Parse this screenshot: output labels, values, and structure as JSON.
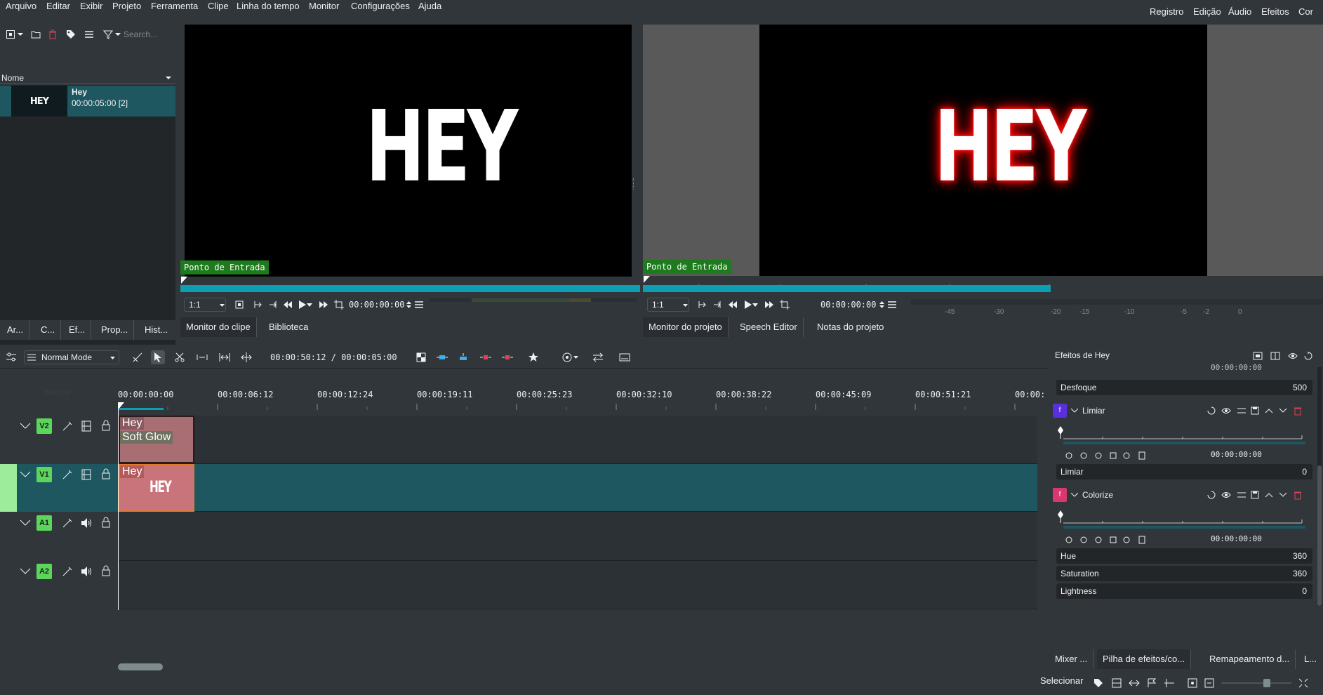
{
  "menu": [
    "Arquivo",
    "Editar",
    "Exibir",
    "Projeto",
    "Ferramenta",
    "Clipe",
    "Linha do tempo",
    "Monitor",
    "Configurações",
    "Ajuda"
  ],
  "workspaces": [
    "Registro",
    "Edição",
    "Áudio",
    "Efeitos",
    "Cor"
  ],
  "bin": {
    "search_placeholder": "Search...",
    "column_header": "Nome",
    "item": {
      "thumb_text": "HEY",
      "name": "Hey",
      "duration": "00:00:05:00 [2]"
    },
    "tabs": [
      "Ar...",
      "C...",
      "Ef...",
      "Prop...",
      "Hist..."
    ]
  },
  "clip_monitor": {
    "text": "HEY",
    "in_point_label": "Ponto de Entrada",
    "zoom": "1:1",
    "timecode": "00:00:00:00",
    "tabs": [
      "Monitor do clipe",
      "Biblioteca"
    ]
  },
  "project_monitor": {
    "text": "HEY",
    "in_point_label": "Ponto de Entrada",
    "zoom": "1:1",
    "timecode": "00:00:00:00",
    "progress_fraction": 0.6,
    "tabs": [
      "Monitor do projeto",
      "Speech Editor",
      "Notas do projeto"
    ],
    "vu_labels": [
      "-45",
      "-30",
      "-20",
      "-15",
      "-10",
      "-5",
      "-2",
      "0"
    ]
  },
  "timeline": {
    "mode": "Normal Mode",
    "position": "00:00:50:12 / 00:00:05:00",
    "master_label": "Mestre",
    "ruler": [
      "00:00:00:00",
      "00:00:06:12",
      "00:00:12:24",
      "00:00:19:11",
      "00:00:25:23",
      "00:00:32:10",
      "00:00:38:22",
      "00:00:45:09",
      "00:00:51:21",
      "00:00:"
    ],
    "tracks": [
      {
        "id": "V2",
        "type": "video"
      },
      {
        "id": "V1",
        "type": "video"
      },
      {
        "id": "A1",
        "type": "audio"
      },
      {
        "id": "A2",
        "type": "audio"
      }
    ],
    "clips": {
      "v2": {
        "name": "Hey",
        "effect": "Soft Glow"
      },
      "v1": {
        "name": "Hey",
        "thumb": "HEY"
      }
    }
  },
  "effects": {
    "title": "Efeitos de Hey",
    "top_timecode": "00:00:00:00",
    "desfoque": {
      "label": "Desfoque",
      "value": "500"
    },
    "limiar": {
      "name": "Limiar",
      "timecode": "00:00:00:00",
      "param_label": "Limiar",
      "param_value": "0",
      "swatch": "#5b2fe0"
    },
    "colorize": {
      "name": "Colorize",
      "timecode": "00:00:00:00",
      "swatch": "#d9376e",
      "params": [
        {
          "label": "Hue",
          "value": "360"
        },
        {
          "label": "Saturation",
          "value": "360"
        },
        {
          "label": "Lightness",
          "value": "0"
        }
      ]
    },
    "bottom_tabs": [
      "Mixer ...",
      "Pilha de efeitos/co...",
      "Remapeamento d...",
      "L..."
    ]
  },
  "status": {
    "label": "Selecionar"
  },
  "colors": {
    "accent": "#0e9eb4",
    "track_active": "#1e5760",
    "green": "#5bd65b",
    "clip_pink": "#c9737b"
  }
}
